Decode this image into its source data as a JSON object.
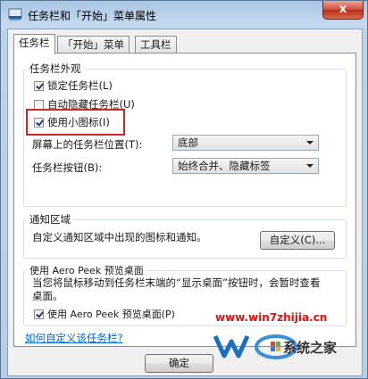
{
  "window": {
    "title": "任务栏和「开始」菜单属性",
    "close_label": "x"
  },
  "tabs": [
    {
      "label": "任务栏",
      "active": true
    },
    {
      "label": "「开始」菜单",
      "active": false
    },
    {
      "label": "工具栏",
      "active": false
    }
  ],
  "appearance": {
    "group_title": "任务栏外观",
    "lock_taskbar": {
      "label": "锁定任务栏(L)",
      "checked": true
    },
    "auto_hide": {
      "label": "自动隐藏任务栏(U)",
      "checked": false
    },
    "small_icons": {
      "label": "使用小图标(I)",
      "checked": true
    },
    "location_label": "屏幕上的任务栏位置(T):",
    "location_value": "底部",
    "buttons_label": "任务栏按钮(B):",
    "buttons_value": "始终合并、隐藏标签"
  },
  "notification": {
    "group_title": "通知区域",
    "description": "自定义通知区域中出现的图标和通知。",
    "customize_button": "自定义(C)..."
  },
  "aero_peek": {
    "group_title": "使用 Aero Peek 预览桌面",
    "description": "当您将鼠标移动到任务栏末端的“显示桌面”按钮时，会暂时查看桌面。",
    "checkbox": {
      "label": "使用 Aero Peek 预览桌面(P)",
      "checked": true
    }
  },
  "help_link": "如何自定义该任务栏?",
  "footer": {
    "ok_button": "确定"
  },
  "watermark": {
    "url": "www.win7zhijia.cn",
    "logo_text": "系统之家"
  },
  "colors": {
    "highlight_box": "#d0262b",
    "link": "#0066cc",
    "watermark_red": "#dd1111"
  }
}
